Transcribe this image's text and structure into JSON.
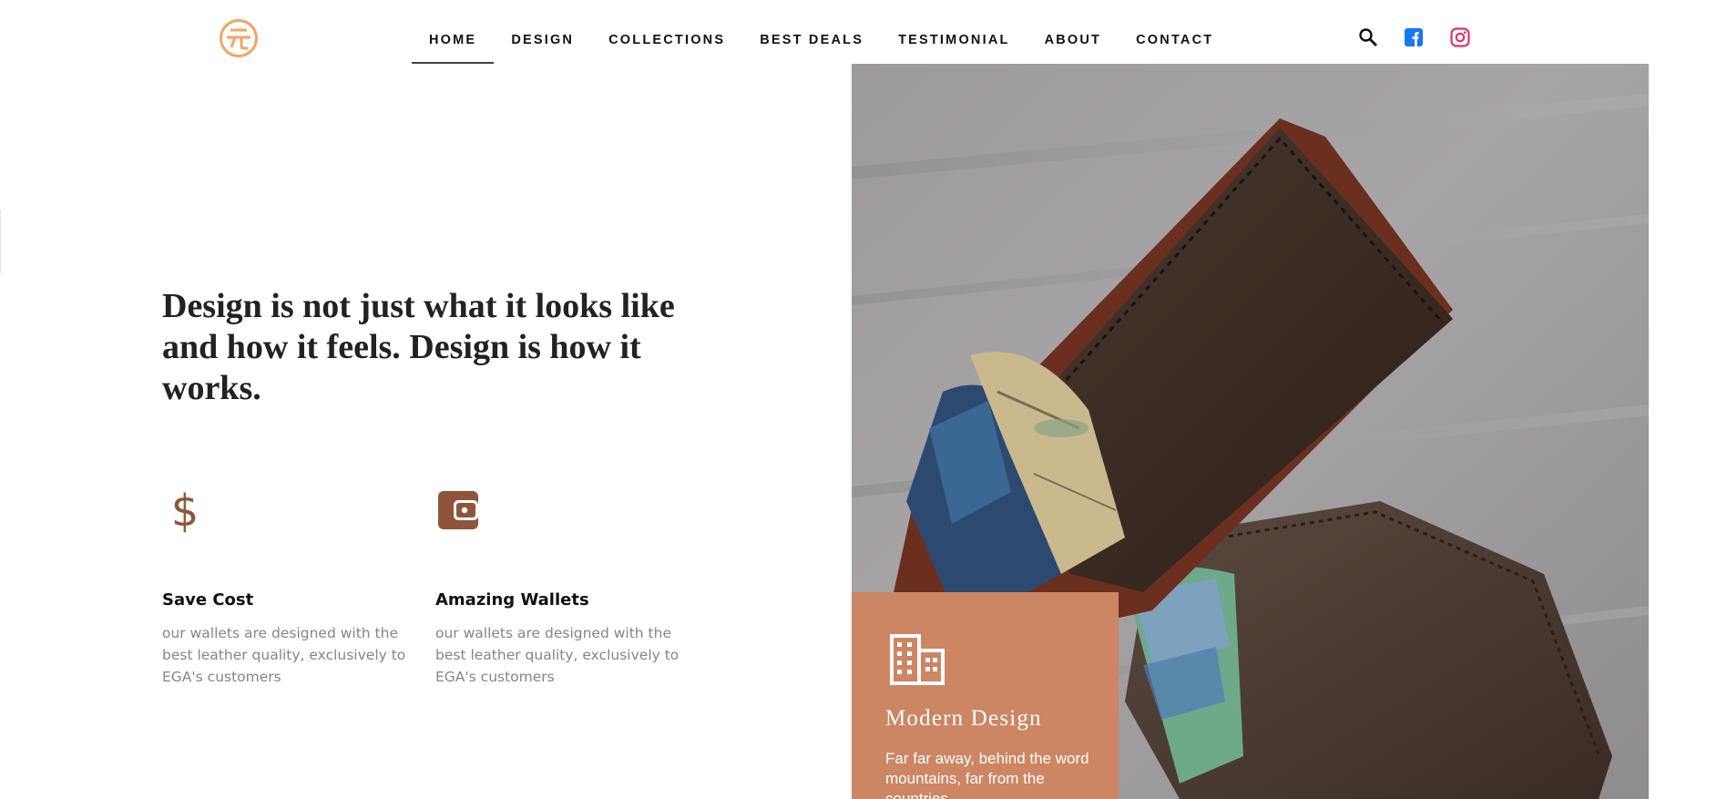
{
  "header": {
    "logo_icon": "circle-glyph-logo",
    "nav": [
      {
        "label": "HOME",
        "active": true
      },
      {
        "label": "DESIGN",
        "active": false
      },
      {
        "label": "COLLECTIONS",
        "active": false
      },
      {
        "label": "BEST DEALS",
        "active": false
      },
      {
        "label": "TESTIMONIAL",
        "active": false
      },
      {
        "label": "ABOUT",
        "active": false
      },
      {
        "label": "CONTACT",
        "active": false
      }
    ],
    "icons": [
      "search-icon",
      "facebook-icon",
      "instagram-icon"
    ]
  },
  "hero": {
    "headline": "Design is not just what it looks like and how it feels. Design is how it works."
  },
  "features": [
    {
      "icon": "dollar-icon",
      "title": "Save Cost",
      "text": "our wallets are designed with the best leather quality, exclusively to EGA's customers"
    },
    {
      "icon": "wallet-icon",
      "title": "Amazing Wallets",
      "text": "our wallets are designed with the best leather quality, exclusively to EGA's customers"
    }
  ],
  "card": {
    "icon": "building-icon",
    "title": "Modern Design",
    "text": "Far far away, behind the word mountains, far from the countries"
  },
  "colors": {
    "logo": "#f3a466",
    "accent": "#cc8663",
    "feature_icon": "#8e553a",
    "facebook": "#1877f2",
    "instagram": "#e1306c"
  }
}
